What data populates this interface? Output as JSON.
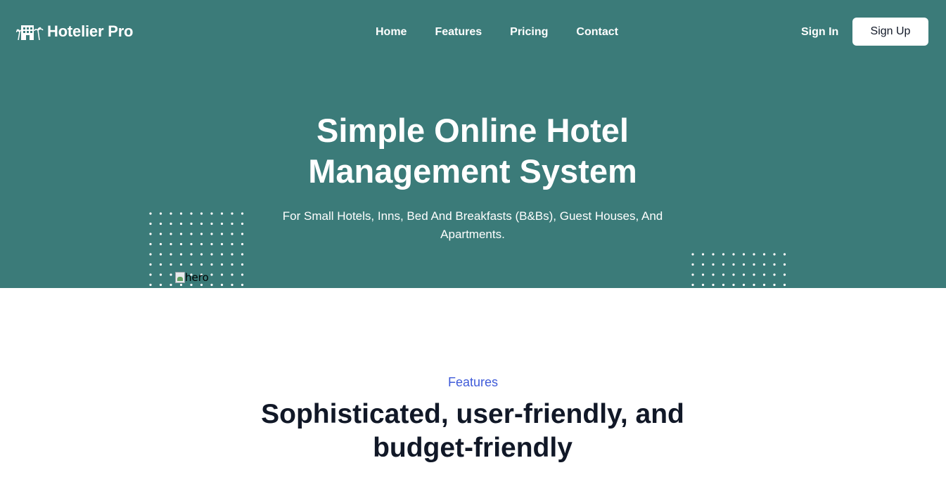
{
  "brand": {
    "name": "Hotelier Pro",
    "icon": "hotel-palm-icon"
  },
  "nav": {
    "items": [
      {
        "label": "Home"
      },
      {
        "label": "Features"
      },
      {
        "label": "Pricing"
      },
      {
        "label": "Contact"
      }
    ]
  },
  "auth": {
    "signin_label": "Sign In",
    "signup_label": "Sign Up"
  },
  "hero": {
    "title": "Simple Online Hotel Management System",
    "subtitle": "For Small Hotels, Inns, Bed And Breakfasts (B&Bs), Guest Houses, And Apartments.",
    "image_alt": "hero"
  },
  "features": {
    "eyebrow": "Features",
    "title": "Sophisticated, user-friendly, and budget-friendly"
  },
  "colors": {
    "hero_bg": "#3b7b79",
    "accent": "#3f5bd9",
    "heading": "#111827",
    "white": "#ffffff"
  }
}
